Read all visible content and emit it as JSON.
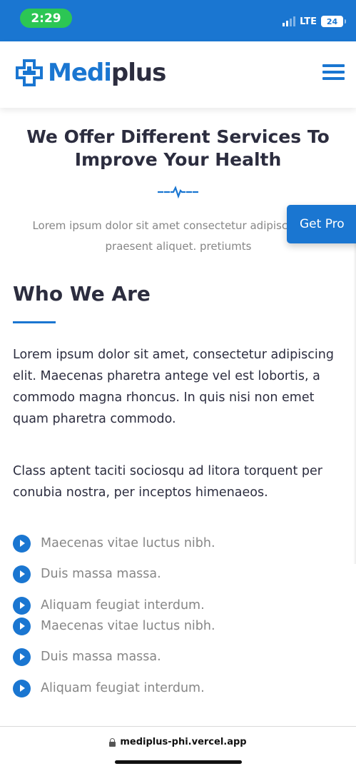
{
  "status_bar": {
    "time": "2:29",
    "network": "LTE",
    "battery": "24",
    "colors": {
      "bar": "#1a76d1",
      "time_pill": "#2cc654"
    }
  },
  "header": {
    "logo_part_1": "Medi",
    "logo_part_2": "plus",
    "logo_icon": "medical-cross-icon",
    "menu_icon": "hamburger-menu-icon"
  },
  "services": {
    "title": "We Offer Different Services To Improve Your Health",
    "divider_icon": "heartbeat-pulse-icon",
    "subtitle": "Lorem ipsum dolor sit amet consectetur adipiscing elit praesent aliquet. pretiumts"
  },
  "floating_button": {
    "label": "Get Pro"
  },
  "who_we_are": {
    "title": "Who We Are",
    "paragraph_1": "Lorem ipsum dolor sit amet, consectetur adipiscing elit. Maecenas pharetra antege vel est lobortis, a commodo magna rhoncus. In quis nisi non emet quam pharetra commodo.",
    "paragraph_2": "Class aptent taciti sociosqu ad litora torquent per conubia nostra, per inceptos himenaeos.",
    "list_icon": "chevron-circle-right-icon",
    "list": [
      "Maecenas vitae luctus nibh.",
      "Duis massa massa.",
      "Aliquam feugiat interdum.",
      "Maecenas vitae luctus nibh.",
      "Duis massa massa.",
      "Aliquam feugiat interdum."
    ]
  },
  "browser": {
    "url": "mediplus-phi.vercel.app"
  },
  "theme": {
    "primary": "#1a76d1",
    "heading": "#2c2d3f",
    "muted": "#868686"
  }
}
